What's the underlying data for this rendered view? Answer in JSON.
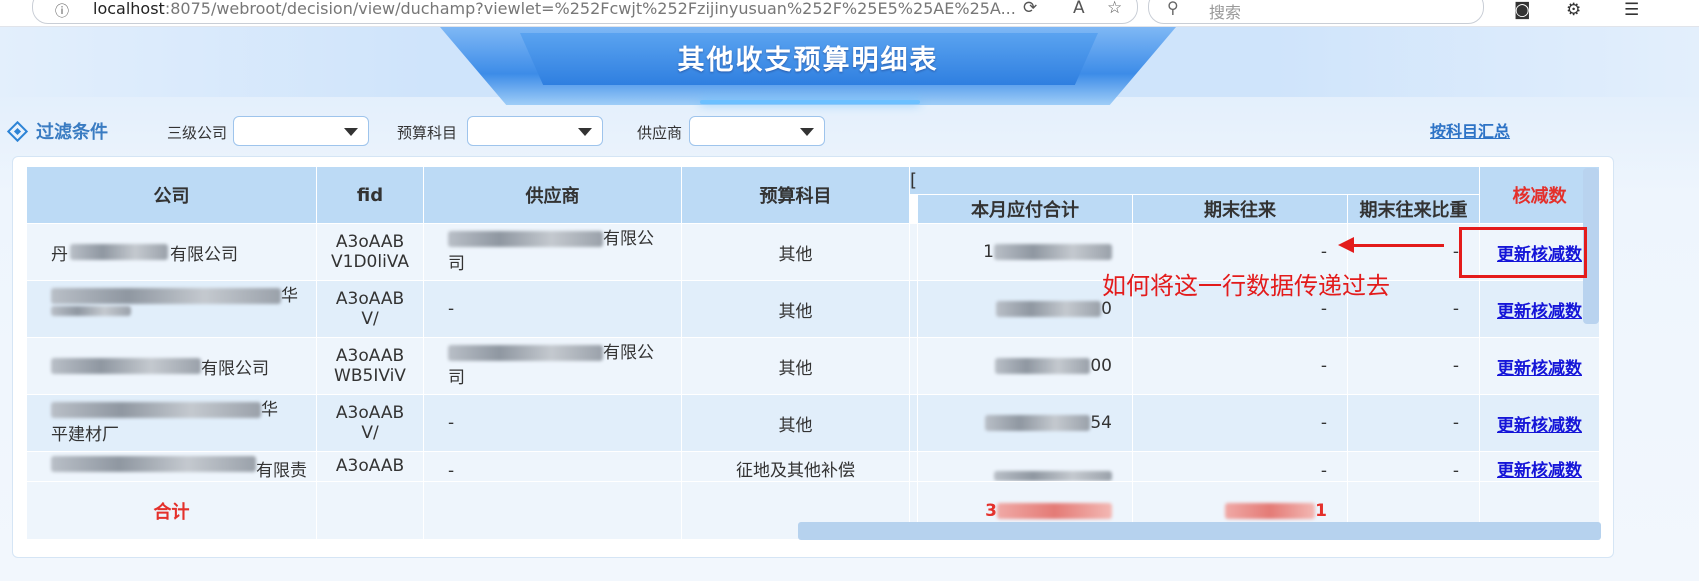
{
  "browser": {
    "url_host": "localhost",
    "url_rest": ":8075/webroot/decision/view/duchamp?viewlet=%252Fcwjt%252Fzijinyusuan%252F%25E5%25AE%25A...",
    "search_placeholder": "搜索"
  },
  "report": {
    "title": "其他收支预算明细表"
  },
  "filters": {
    "title": "过滤条件",
    "company_label": "三级公司",
    "subject_label": "预算科目",
    "supplier_label": "供应商",
    "summary_link": "按科目汇总"
  },
  "table": {
    "headers": {
      "company": "公司",
      "fid": "fid",
      "supplier": "供应商",
      "subject": "预算科目",
      "group_marker": "[",
      "monthly_payable": "本月应付合计",
      "period_end": "期末往来",
      "period_end_ratio": "期末往来比重",
      "reduction": "核减数"
    },
    "rows": [
      {
        "company": "有限公司",
        "fid_1": "A3oAAB",
        "fid_2": "V1D0liVA",
        "supplier": "有限公",
        "supplier_2": "司",
        "subject": "其他",
        "monthly": "",
        "period_end": "-",
        "ratio": "-",
        "action": "更新核减数"
      },
      {
        "company": "华",
        "company_2": "",
        "fid_1": "A3oAAB",
        "fid_2": "V/",
        "supplier": "-",
        "subject": "其他",
        "monthly": "0",
        "period_end": "-",
        "ratio": "-",
        "action": "更新核减数"
      },
      {
        "company": "有限公司",
        "fid_1": "A3oAAB",
        "fid_2": "WB5IViV",
        "supplier": "有限公",
        "supplier_2": "司",
        "subject": "其他",
        "monthly": "00",
        "period_end": "-",
        "ratio": "-",
        "action": "更新核减数"
      },
      {
        "company": "华",
        "company_2": "平建材厂",
        "fid_1": "A3oAAB",
        "fid_2": "V/",
        "supplier": "-",
        "subject": "其他",
        "monthly": "54",
        "period_end": "-",
        "ratio": "-",
        "action": "更新核减数"
      },
      {
        "company": "有限责",
        "fid_1": "A3oAAB",
        "fid_2": "",
        "supplier": "-",
        "subject": "征地及其他补偿",
        "monthly": "",
        "period_end": "-",
        "ratio": "-",
        "action": "更新核减数"
      }
    ],
    "total_label": "合计",
    "total_period_end": "1"
  },
  "annotation": {
    "text": "如何将这一行数据传递过去"
  },
  "colors": {
    "accent": "#2d84d6",
    "header_bg": "#bcdaf5",
    "annotation_red": "#e31b1b",
    "link_blue": "#1515d8"
  }
}
